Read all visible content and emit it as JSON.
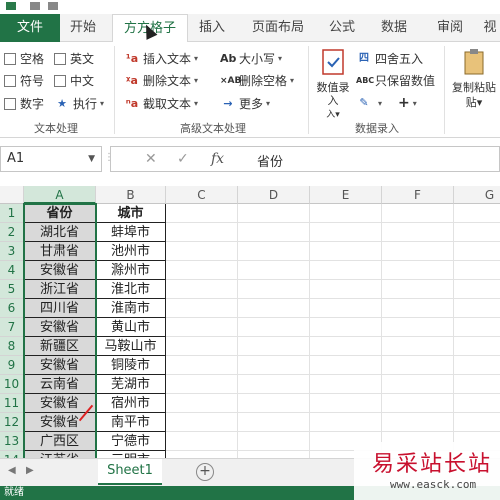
{
  "ribbon_tabs": [
    "文件",
    "开始",
    "方方格子",
    "插入",
    "页面布局",
    "公式",
    "数据",
    "审阅",
    "视"
  ],
  "ribbon": {
    "checkboxes": [
      "空格",
      "英文",
      "符号",
      "中文",
      "数字"
    ],
    "exec_label": "执行",
    "text_cmds": [
      "插入文本",
      "删除文本",
      "截取文本"
    ],
    "case_cmds": [
      "大小写",
      "删除空格",
      "更多"
    ],
    "numentry_big": "数值录入",
    "round_label": "四舍五入",
    "keep_value_label": "只保留数值",
    "copy_paste_label": "复制粘贴",
    "group_labels": [
      "文本处理",
      "高级文本处理",
      "数据录入"
    ],
    "icons": {
      "insert_text": "insert-text-icon",
      "delete_text": "delete-text-icon",
      "extract_text": "extract-text-icon",
      "case": "case-icon",
      "delete_space": "delete-space-icon",
      "more": "arrow-right-icon",
      "round": "round-icon",
      "keep_value": "keep-value-icon"
    },
    "icon_glyphs": {
      "insert_text": "¹a",
      "delete_text": "ᵡa",
      "extract_text": "ⁿa",
      "case": "Ab",
      "delete_space": "×AB",
      "more": "→",
      "round": "四",
      "keep_value": "ABC"
    }
  },
  "formula_bar": {
    "name_box": "A1",
    "fx_symbol": "fx",
    "content": "省份"
  },
  "grid": {
    "columns": [
      "A",
      "B",
      "C",
      "D",
      "E",
      "F",
      "G"
    ],
    "rows": [
      "1",
      "2",
      "3",
      "4",
      "5",
      "6",
      "7",
      "8",
      "9",
      "10",
      "11",
      "12",
      "13",
      "14"
    ],
    "header_row": [
      "省份",
      "城市"
    ],
    "data": [
      [
        "湖北省",
        "蚌埠市"
      ],
      [
        "甘肃省",
        "池州市"
      ],
      [
        "安徽省",
        "滁州市"
      ],
      [
        "浙江省",
        "淮北市"
      ],
      [
        "四川省",
        "淮南市"
      ],
      [
        "安徽省",
        "黄山市"
      ],
      [
        "新疆区",
        "马鞍山市"
      ],
      [
        "安徽省",
        "铜陵市"
      ],
      [
        "云南省",
        "芜湖市"
      ],
      [
        "安徽省",
        "宿州市"
      ],
      [
        "安徽省",
        "南平市"
      ],
      [
        "广西区",
        "宁德市"
      ],
      [
        "江苏省",
        "三明市"
      ]
    ]
  },
  "sheet_tabs": [
    "Sheet1"
  ],
  "status": "就绪",
  "watermark": {
    "cn": "易采站长站",
    "url": "www.easck.com"
  }
}
